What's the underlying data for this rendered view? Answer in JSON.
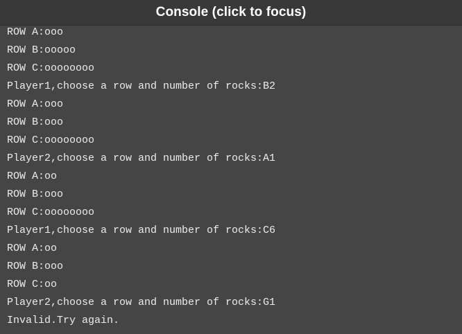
{
  "header": {
    "title": "Console (click to focus)"
  },
  "console": {
    "lines": [
      "ROW A:ooo",
      "ROW B:ooooo",
      "ROW C:oooooooo",
      "Player1,choose a row and number of rocks:B2",
      "ROW A:ooo",
      "ROW B:ooo",
      "ROW C:oooooooo",
      "Player2,choose a row and number of rocks:A1",
      "ROW A:oo",
      "ROW B:ooo",
      "ROW C:oooooooo",
      "Player1,choose a row and number of rocks:C6",
      "ROW A:oo",
      "ROW B:ooo",
      "ROW C:oo",
      "Player2,choose a row and number of rocks:G1",
      "Invalid.Try again."
    ]
  }
}
